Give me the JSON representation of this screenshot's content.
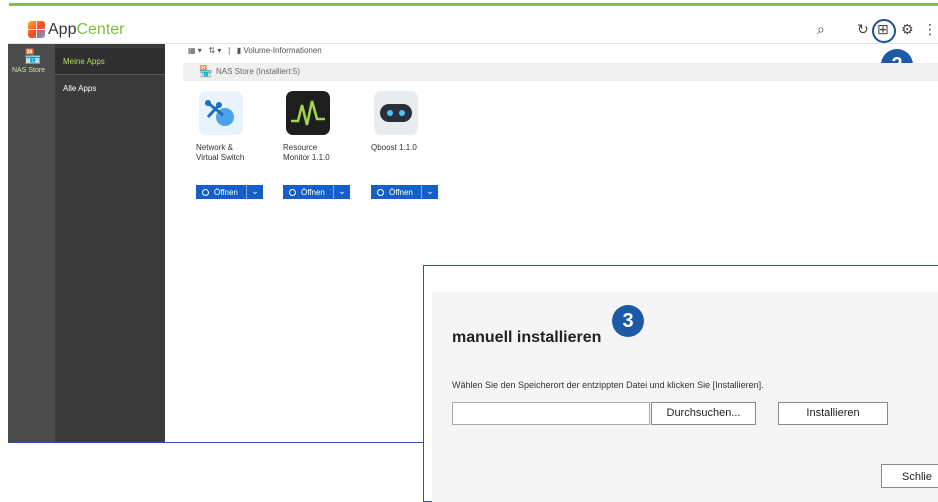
{
  "app": {
    "title_prefix": "App",
    "title_suffix": "Center"
  },
  "header_icons": {
    "search": "search-icon",
    "refresh": "refresh-icon",
    "install": "manual-install-icon",
    "settings": "gear-icon",
    "more": "more-icon"
  },
  "header_glyphs": {
    "search": "⌕",
    "refresh": "↻",
    "install": "⊞",
    "settings": "⚙",
    "more": "⋮"
  },
  "badges": {
    "step2": "2",
    "step3": "3"
  },
  "sidebar": {
    "store_label": "NAS Store",
    "items": [
      {
        "label": "Meine Apps"
      },
      {
        "label": "Alle Apps"
      }
    ]
  },
  "toolbar": {
    "grid": "▦ ▾",
    "sort": "⇅ ▾",
    "sep": "|",
    "volume": "Volume-Informationen"
  },
  "section": {
    "title": "NAS Store (Installiert:5)"
  },
  "apps": [
    {
      "name_line1": "Network &",
      "name_line2": "Virtual Switch",
      "open_label": "Öffnen",
      "icon_bg": "#e8f3fb"
    },
    {
      "name_line1": "Resource",
      "name_line2": "Monitor 1.1.0",
      "open_label": "Öffnen",
      "icon_bg": "#1e1e1e"
    },
    {
      "name_line1": "Qboost 1.1.0",
      "name_line2": "",
      "open_label": "Öffnen",
      "icon_bg": "#e9ecef"
    }
  ],
  "dialog": {
    "title": "manuell installieren",
    "instruction": "Wählen Sie den Speicherort der entzippten Datei und klicken Sie [Installieren].",
    "input_value": "",
    "browse_label": "Durchsuchen...",
    "install_label": "Installieren",
    "close_label": "Schlie"
  },
  "colors": {
    "accent_green": "#7fc34a",
    "primary_blue": "#1460c8",
    "badge_blue": "#1c5aa8",
    "sidebar_dark": "#3b3b3b"
  }
}
